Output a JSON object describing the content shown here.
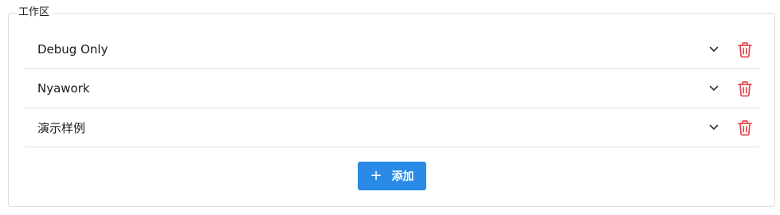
{
  "section": {
    "legend": "工作区"
  },
  "workspaces": [
    {
      "label": "Debug Only"
    },
    {
      "label": "Nyawork"
    },
    {
      "label": "演示样例"
    }
  ],
  "actions": {
    "add_label": "添加",
    "add_icon": "+"
  },
  "colors": {
    "accent": "#2a8be6",
    "danger": "#e5484d"
  },
  "icons": {
    "expand": "chevron-down-icon",
    "delete": "trash-icon",
    "add": "plus-icon"
  }
}
